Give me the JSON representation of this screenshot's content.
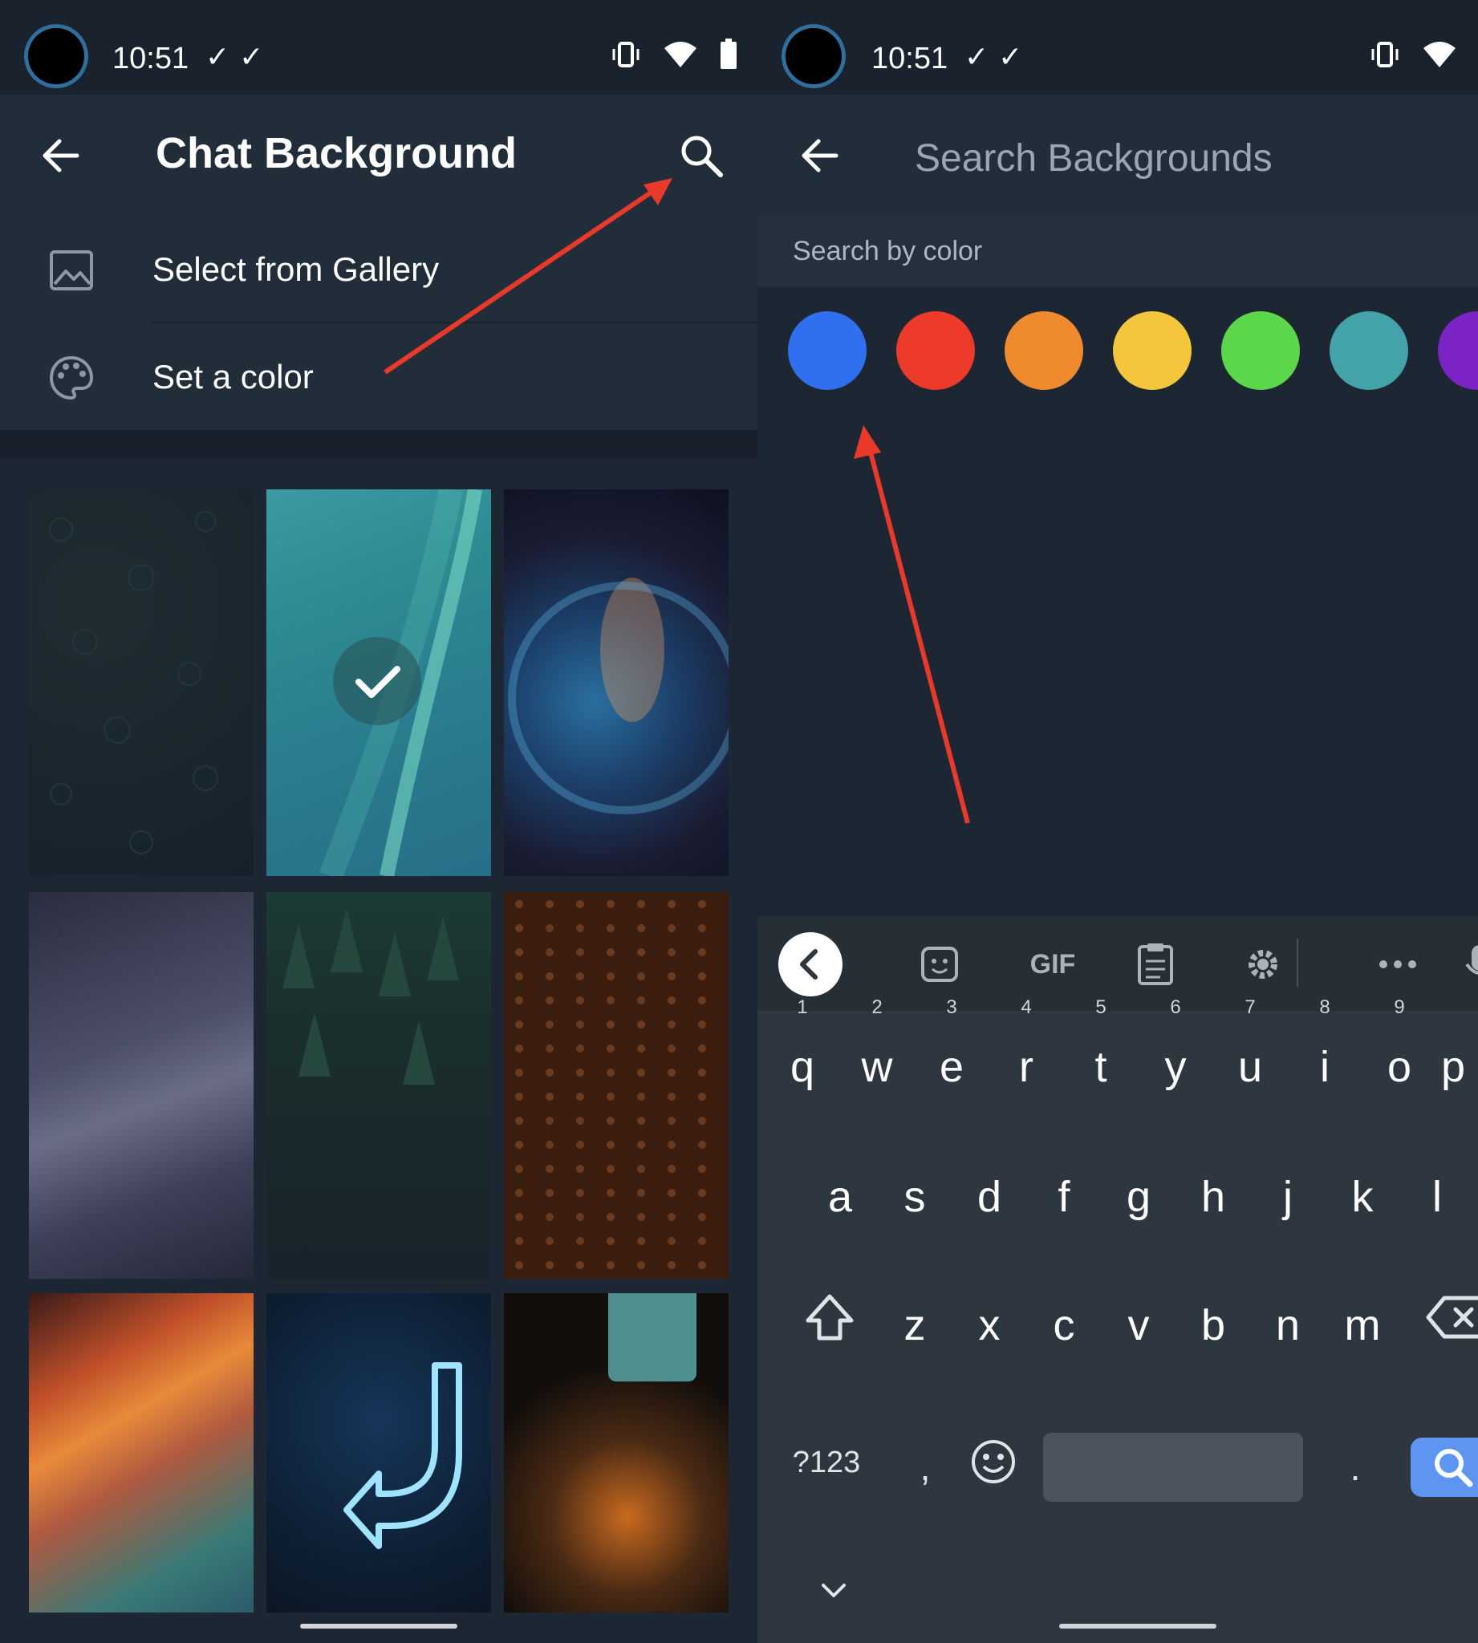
{
  "left_screen": {
    "status": {
      "time": "10:51",
      "checks": "✓✓"
    },
    "toolbar": {
      "title": "Chat Background"
    },
    "menu": {
      "gallery_label": "Select from Gallery",
      "color_label": "Set a color"
    },
    "wallpapers": [
      {
        "name": "dark-pattern",
        "selected": false
      },
      {
        "name": "aurora",
        "selected": true
      },
      {
        "name": "nebula",
        "selected": false
      },
      {
        "name": "milky-way",
        "selected": false
      },
      {
        "name": "forest",
        "selected": false
      },
      {
        "name": "coffee-beans",
        "selected": false
      },
      {
        "name": "light-streaks",
        "selected": false
      },
      {
        "name": "neon-arrow",
        "selected": false
      },
      {
        "name": "light-bulb",
        "selected": false
      }
    ]
  },
  "right_screen": {
    "status": {
      "time": "10:51",
      "checks": "✓✓"
    },
    "search": {
      "placeholder": "Search Backgrounds"
    },
    "section_label": "Search by color",
    "colors": [
      "#2f6ff0",
      "#ee3a2a",
      "#f08a2e",
      "#f5c53c",
      "#5cd64a",
      "#44a3a8",
      "#7b23c4"
    ],
    "keyboard": {
      "toolbar": {
        "gif_label": "GIF"
      },
      "row1": [
        "q",
        "w",
        "e",
        "r",
        "t",
        "y",
        "u",
        "i",
        "o",
        "p"
      ],
      "row1_hints": [
        "1",
        "2",
        "3",
        "4",
        "5",
        "6",
        "7",
        "8",
        "9"
      ],
      "row2": [
        "a",
        "s",
        "d",
        "f",
        "g",
        "h",
        "j",
        "k",
        "l"
      ],
      "row3": [
        "z",
        "x",
        "c",
        "v",
        "b",
        "n",
        "m"
      ],
      "symbols_label": "?123",
      "comma": ",",
      "period": "."
    }
  },
  "annotation_color": "#e8392b"
}
